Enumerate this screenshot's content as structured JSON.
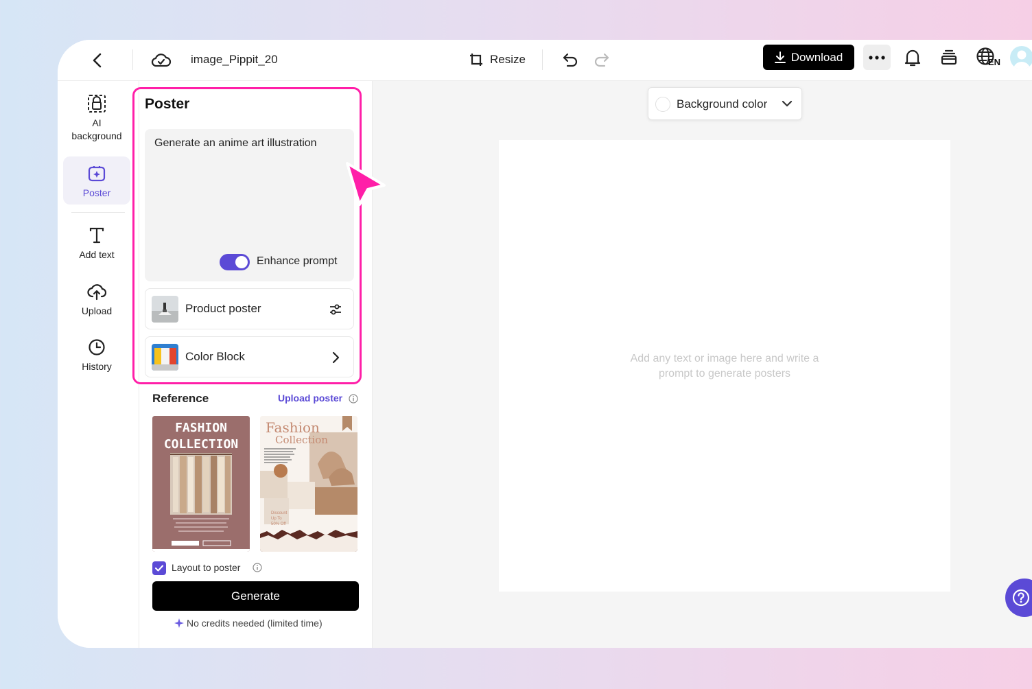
{
  "topbar": {
    "file_name": "image_Pippit_20",
    "resize_label": "Resize",
    "download_label": "Download",
    "language_code": "EN"
  },
  "sidebar": {
    "items": [
      {
        "label": "AI\nbackground",
        "icon": "ai-background-icon"
      },
      {
        "label": "Poster",
        "icon": "poster-icon",
        "active": true
      },
      {
        "label": "Add text",
        "icon": "text-icon"
      },
      {
        "label": "Upload",
        "icon": "upload-cloud-icon"
      },
      {
        "label": "History",
        "icon": "clock-icon"
      }
    ]
  },
  "panel": {
    "title": "Poster",
    "prompt_value": "Generate an anime art illustration",
    "enhance_prompt_label": "Enhance prompt",
    "enhance_prompt_on": true,
    "product_poster_label": "Product poster",
    "color_block_label": "Color Block",
    "reference_title": "Reference",
    "upload_poster_label": "Upload poster",
    "reference_cards": [
      {
        "title_line1": "FASHION",
        "title_line2": "COLLECTION"
      },
      {
        "title_line1": "Fashion",
        "title_line2": "Collection",
        "discount": "Discount\nUp To\n50% Off"
      }
    ],
    "layout_to_poster_label": "Layout to poster",
    "layout_to_poster_checked": true,
    "generate_label": "Generate",
    "credits_note": "No credits needed (limited time)"
  },
  "canvas": {
    "background_color_label": "Background color",
    "hint_line1": "Add any text or image here and write a",
    "hint_line2": "prompt to generate posters"
  },
  "colors": {
    "accent": "#5b4ad6",
    "highlight": "#ff1fa8",
    "primary_button": "#000000"
  }
}
